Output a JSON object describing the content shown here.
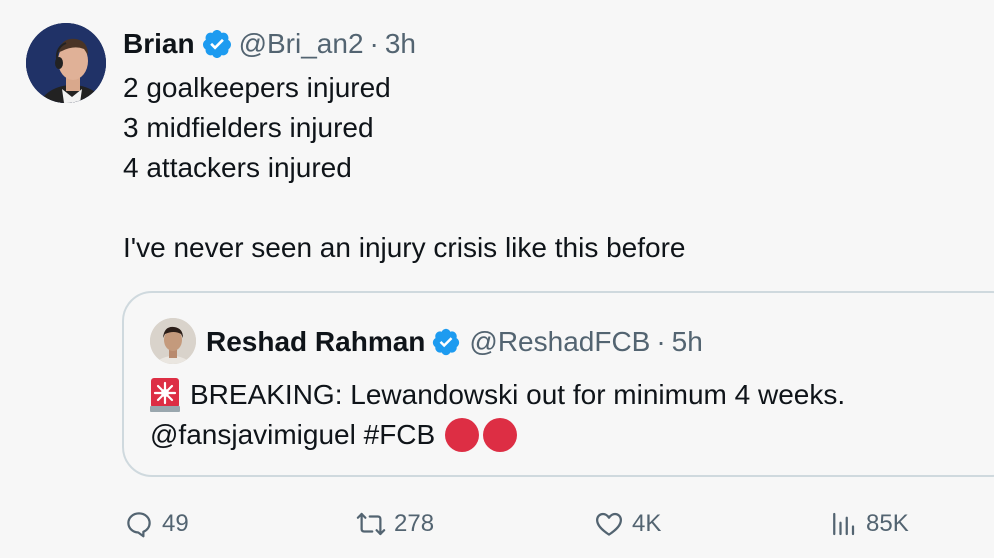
{
  "tweet": {
    "author": {
      "name": "Brian",
      "handle": "@Bri_an2",
      "separator": "·",
      "time": "3h",
      "verified": true
    },
    "text_lines": [
      "2 goalkeepers injured",
      "3 midfielders injured",
      "4 attackers injured",
      "",
      "I've never seen an injury crisis like this before"
    ],
    "quote": {
      "author": {
        "name": "Reshad Rahman",
        "handle": "@ReshadFCB",
        "separator": "·",
        "time": "5h",
        "verified": true
      },
      "line1": "BREAKING: Lewandowski out for minimum 4 weeks.",
      "mention": "@fansjavimiguel",
      "hashtag": "#FCB",
      "emoji": [
        "siren-emoji",
        "red-circle-emoji",
        "red-circle-emoji"
      ]
    },
    "actions": {
      "replies": "49",
      "retweets": "278",
      "likes": "4K",
      "views": "85K"
    }
  },
  "colors": {
    "background": "#f7f7f7",
    "text": "#0f1419",
    "secondary": "#536471",
    "verified": "#1d9bf0",
    "border": "#cfd9de",
    "red_circle": "#dd2e44"
  },
  "icons": [
    "verified-badge-icon",
    "reply-icon",
    "retweet-icon",
    "like-icon",
    "views-icon"
  ]
}
